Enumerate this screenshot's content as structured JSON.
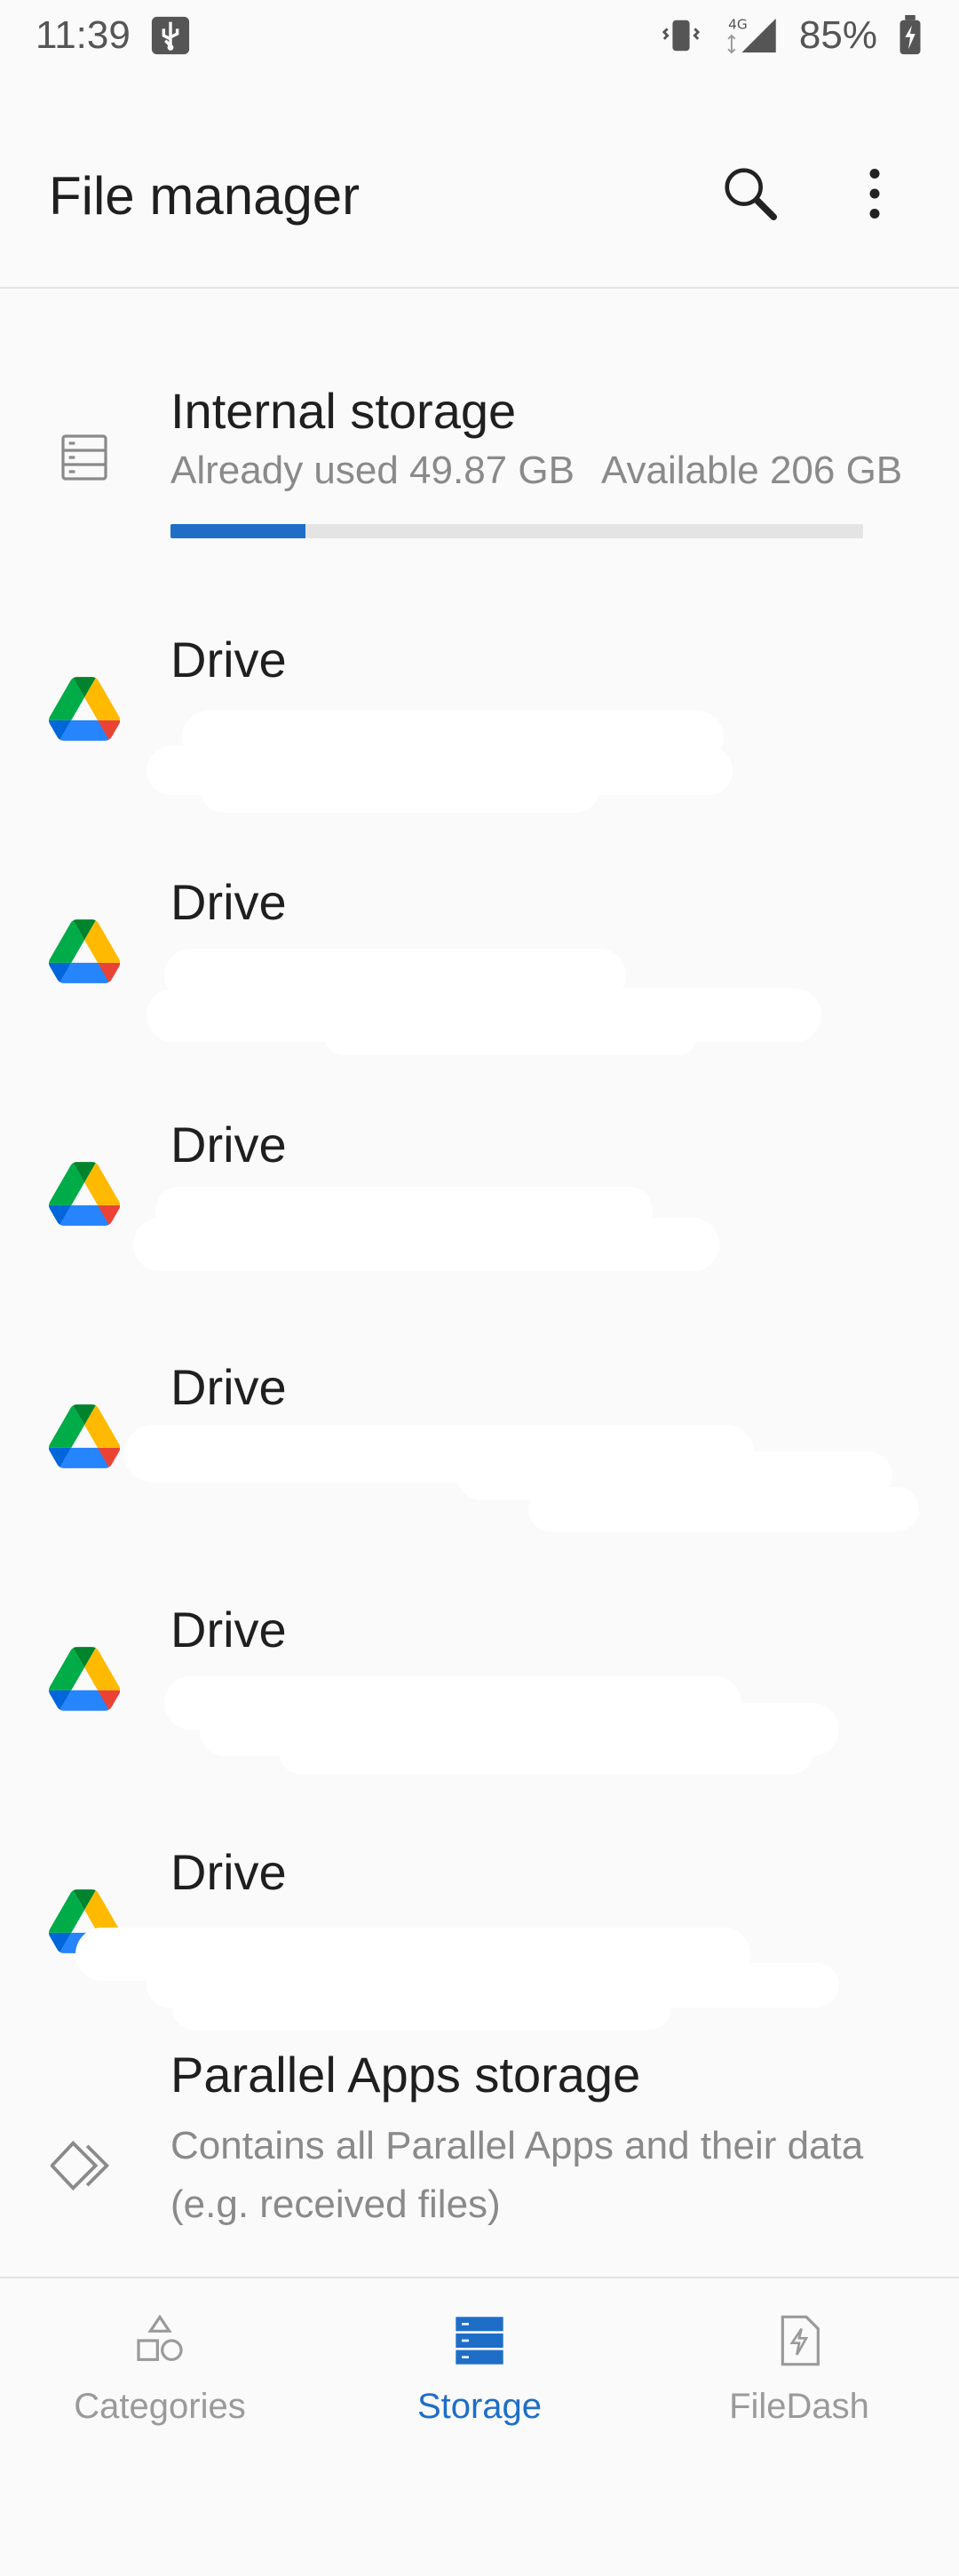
{
  "status_bar": {
    "time": "11:39",
    "battery": "85%",
    "network": "4G"
  },
  "app_bar": {
    "title": "File manager",
    "search_icon": "search-icon",
    "more_icon": "more-vert-icon"
  },
  "internal_storage": {
    "title": "Internal storage",
    "used": "Already used 49.87 GB",
    "available": "Available 206 GB",
    "used_fraction": 0.195,
    "icon": "storage-icon",
    "accent": "#1e6ec8"
  },
  "drives": [
    {
      "title": "Drive",
      "icon": "google-drive-icon"
    },
    {
      "title": "Drive",
      "icon": "google-drive-icon"
    },
    {
      "title": "Drive",
      "icon": "google-drive-icon"
    },
    {
      "title": "Drive",
      "icon": "google-drive-icon"
    },
    {
      "title": "Drive",
      "icon": "google-drive-icon"
    },
    {
      "title": "Drive",
      "icon": "google-drive-icon"
    }
  ],
  "parallel_apps": {
    "title": "Parallel Apps storage",
    "subtitle": "Contains all Parallel Apps and their data (e.g. received files)",
    "icon": "parallel-apps-icon"
  },
  "bottom_nav": {
    "items": [
      {
        "label": "Categories",
        "icon": "categories-icon",
        "active": false
      },
      {
        "label": "Storage",
        "icon": "storage-stack-icon",
        "active": true
      },
      {
        "label": "FileDash",
        "icon": "filedash-icon",
        "active": false
      }
    ]
  }
}
